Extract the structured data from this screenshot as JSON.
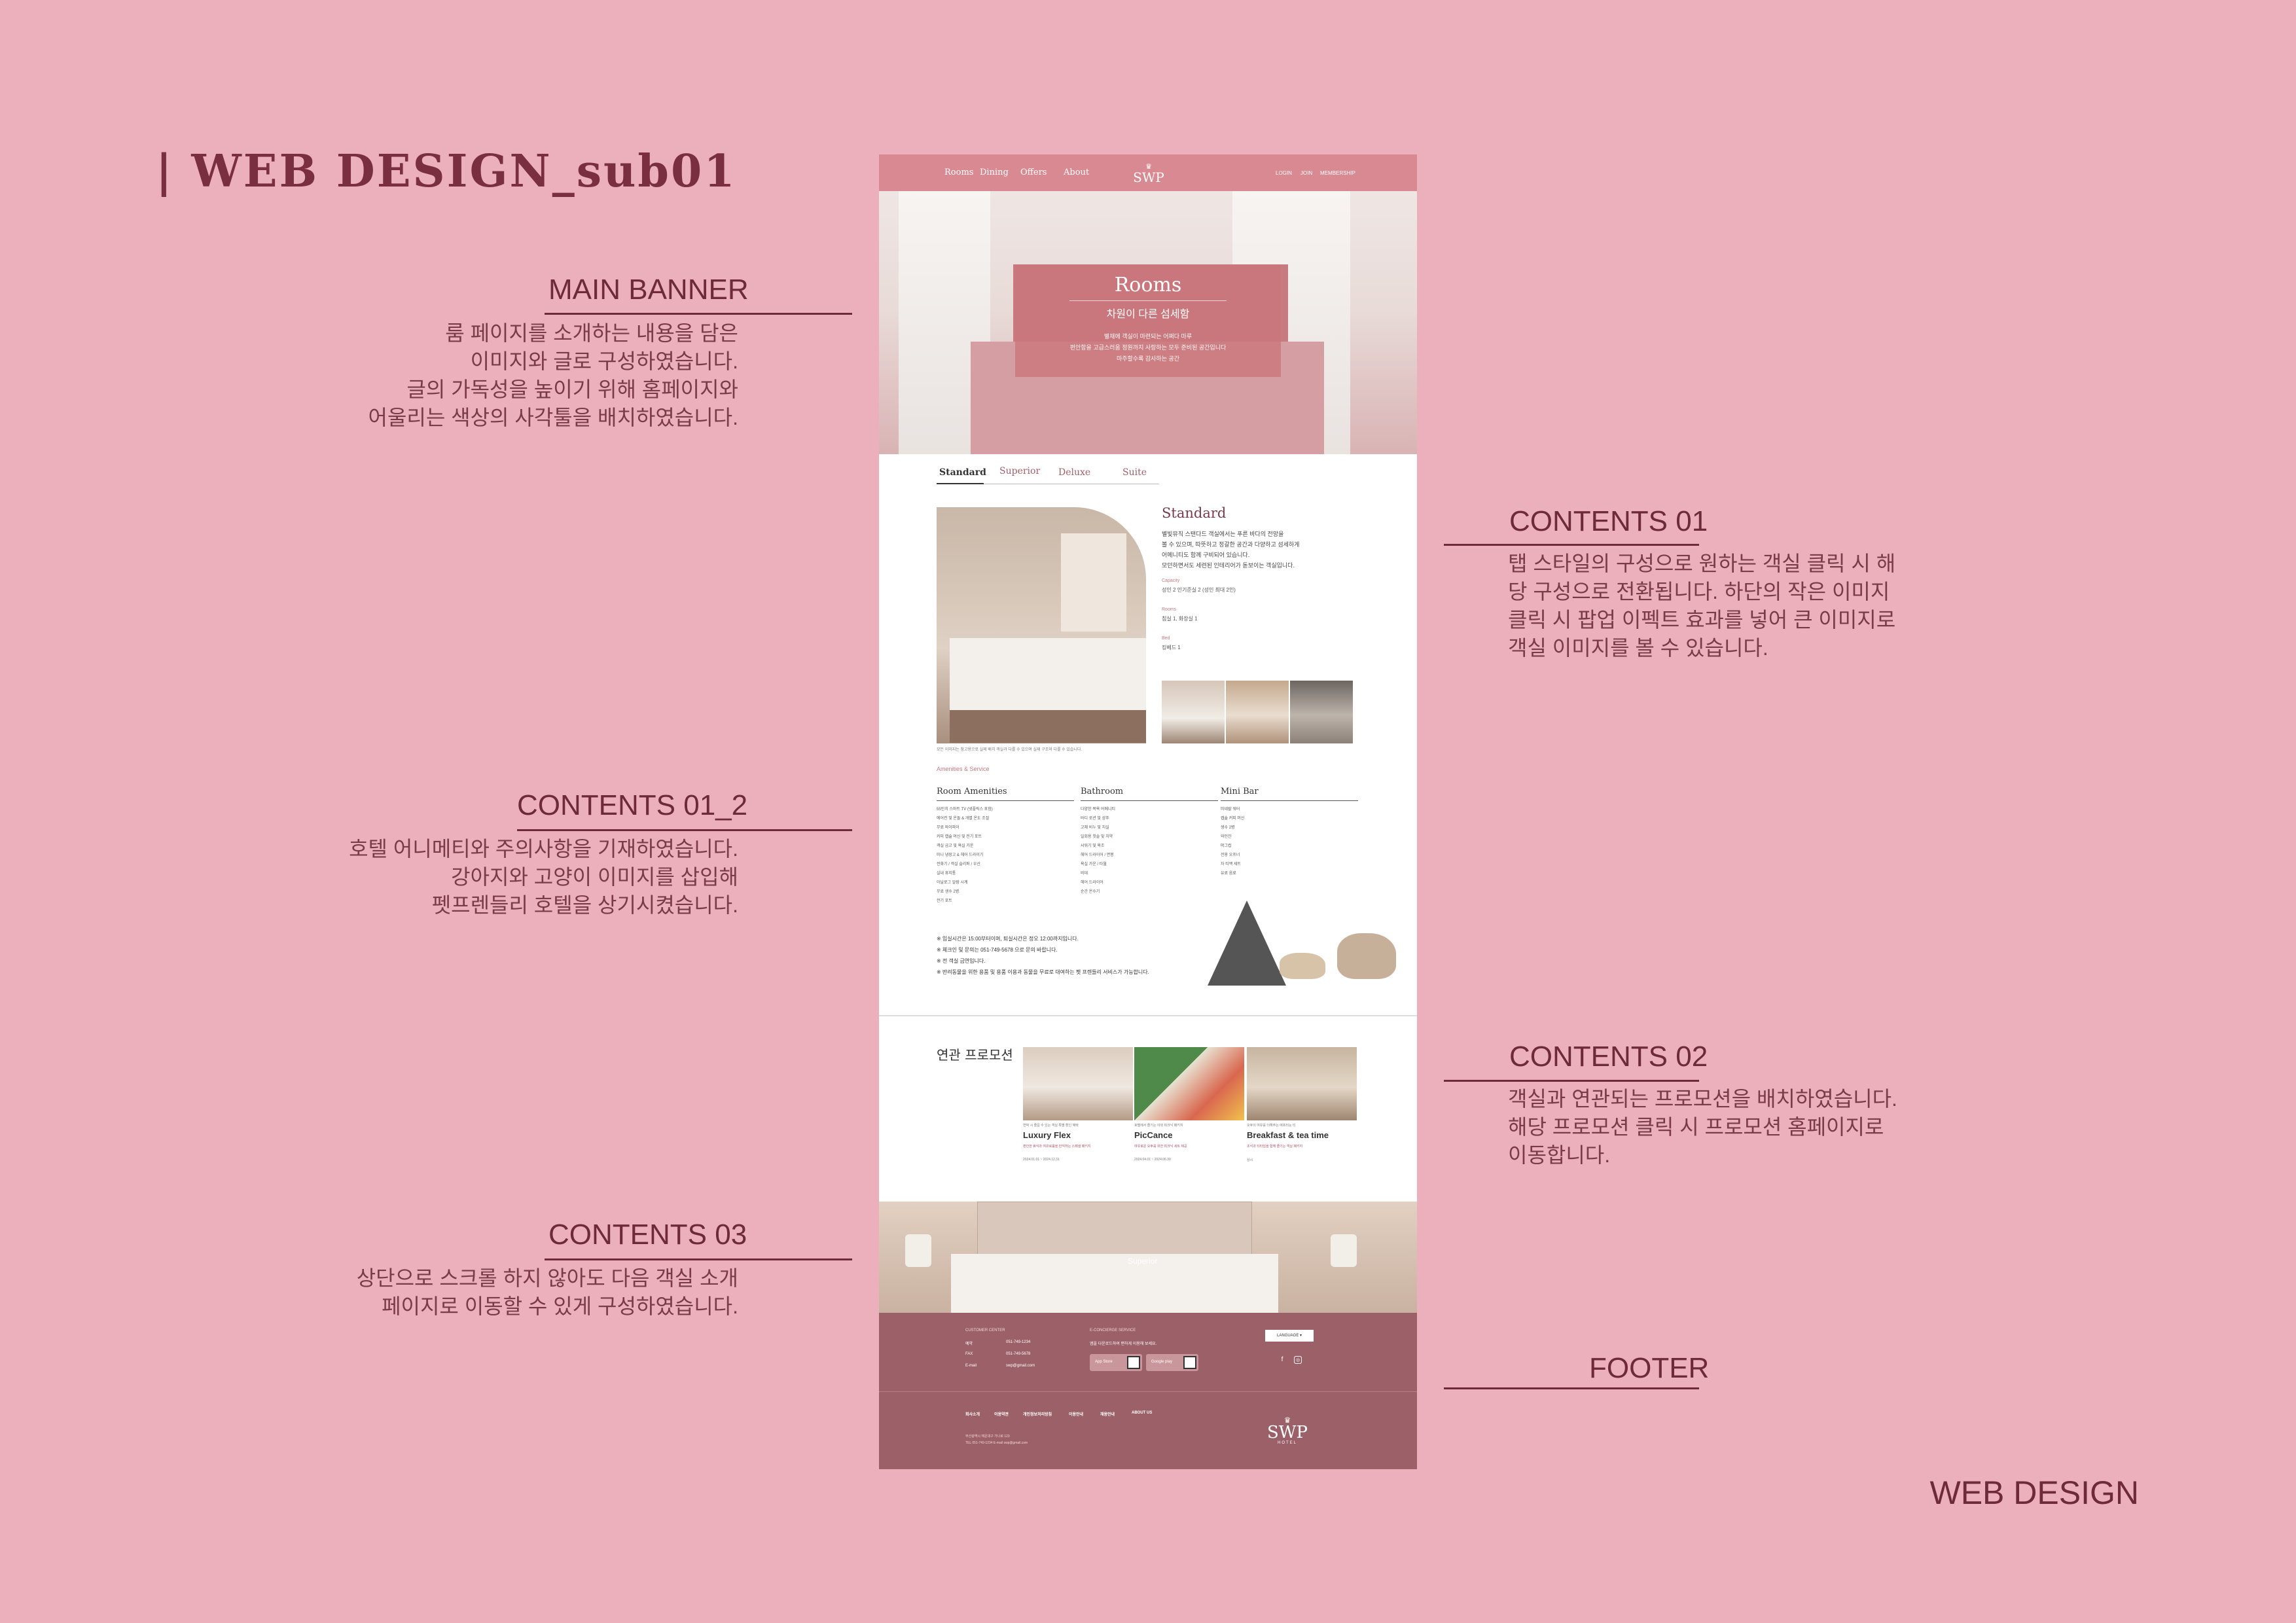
{
  "page_title": "| WEB  DESIGN_sub01",
  "footer_tag": "WEB DESIGN",
  "annotations": {
    "main_banner": {
      "title": "MAIN BANNER",
      "lines": [
        "룸 페이지를 소개하는 내용을 담은",
        "이미지와 글로 구성하였습니다.",
        "글의 가독성을 높이기 위해 홈페이지와",
        "어울리는 색상의 사각툴을 배치하였습니다."
      ]
    },
    "contents01": {
      "title": "CONTENTS 01",
      "lines": [
        "탭 스타일의 구성으로 원하는 객실 클릭 시 해",
        "당 구성으로 전환됩니다. 하단의 작은 이미지",
        "클릭 시 팝업 이펙트 효과를 넣어 큰 이미지로",
        "객실 이미지를 볼 수 있습니다."
      ]
    },
    "contents01_2": {
      "title": "CONTENTS 01_2",
      "lines": [
        "호텔 어니메티와 주의사항을 기재하였습니다.",
        "강아지와 고양이 이미지를 삽입해",
        "펫프렌들리 호텔을 상기시켰습니다."
      ]
    },
    "contents02": {
      "title": "CONTENTS 02",
      "lines": [
        "객실과 연관되는 프로모션을 배치하였습니다.",
        "해당 프로모션 클릭 시 프로모션 홈페이지로",
        "이동합니다."
      ]
    },
    "contents03": {
      "title": "CONTENTS 03",
      "lines": [
        "상단으로 스크롤 하지 않아도 다음 객실 소개",
        "페이지로 이동할 수 있게 구성하였습니다."
      ]
    },
    "footer": {
      "title": "FOOTER"
    }
  },
  "site": {
    "nav": [
      "Rooms",
      "Dining",
      "Offers",
      "About"
    ],
    "logo": "SWP",
    "logo_crown": "♛",
    "util": [
      "LOGIN",
      "JOIN",
      "MEMBERSHIP"
    ],
    "banner": {
      "title": "Rooms",
      "subtitle": "차원이 다른 섬세함",
      "desc": [
        "별채에 객실이 마련되는 어쩌다 마루",
        "편안함을 고급스러움 정원까지 사랑하는 모두 준비된 공간입니다",
        "마주할수록 감사하는 공간"
      ]
    },
    "tabs": [
      "Standard",
      "Superior",
      "Deluxe",
      "Suite"
    ],
    "room": {
      "name": "Standard",
      "desc": [
        "별빛뮤직 스탠다드 객실에서는 푸른 바다의 전망을",
        "볼 수 있으며, 따뜻하고 정갈한 공간과 다양하고 섬세하게",
        "어메니티도 함께 구비되어 있습니다.",
        "모던하면서도 세련된 인테리어가 돋보이는 객실입니다."
      ],
      "capacity_label": "Capacity",
      "capacity": "성인 2 인기준실 2 (성인 최대 2인)",
      "rooms_label": "Rooms",
      "rooms": "침실 1, 화장실 1",
      "bed_label": "Bed",
      "bed": "킹베드 1",
      "caption": "모든 이미지는 참고용으로 실제 배치 객실과 다를 수 있으며 실제 구조와 다를 수 있습니다."
    },
    "amenities": {
      "heading": "Amenities & Service",
      "columns": [
        {
          "title": "Room Amenities",
          "items": [
            "55인치 스마트 TV (넷플릭스 포함)",
            "에어컨 및 온돌 & 개별 온도 조절",
            "무료 와이파이",
            "커피 캡슐 머신 및 전기 포트",
            "객실 금고 및 욕실 가운",
            "미니 냉장고 & 헤어 드라이기",
            "전화기 / 객실 슬리퍼 / 우산",
            "실내 휴지통",
            "아날로그 알람 시계",
            "무료 생수 2병",
            "전기 포트"
          ]
        },
        {
          "title": "Bathroom",
          "items": [
            "다양한 목욕 어메니티",
            "바디 로션 및 샴푸",
            "고체 비누 및 치실",
            "일회용 칫솔 및 치약",
            "샤워기 및 욕조",
            "헤어 드라이어 / 면봉",
            "욕실 가운 / 타월",
            "비데",
            "헤어 드라이어",
            "순간 온수기"
          ]
        },
        {
          "title": "Mini Bar",
          "items": [
            "미네랄 워터",
            "캡슐 커피 머신",
            "생수 2병",
            "와인잔",
            "머그컵",
            "전용 오프너",
            "차 티백 세트",
            "유료 음료"
          ]
        }
      ],
      "notes": [
        "※ 입실시간은 15:00부터이며, 퇴실시간은 정오 12:00까지입니다.",
        "※ 체크인 및 문의는 051-749-5678 으로 문의 바랍니다.",
        "※ 전 객실 금연입니다.",
        "※ 반려동물을 위한 용품 및 용품 이용과 동물을 무료로 대여하는 펫 프렌들리 서비스가 가능합니다."
      ]
    },
    "promo": {
      "title": "연관 프로모션",
      "items": [
        {
          "small": "연박 시 즐길 수 있는 객실 특별 할인 혜택",
          "name": "Luxury Flex",
          "desc": "편안한 휴식과 여유로움을 만끽하는 스페셜 패키지",
          "date": "2024.01.01 ~ 2024.12.31"
        },
        {
          "small": "호텔에서 즐기는 야외 피크닉 패키지",
          "name": "PicCance",
          "desc": "여유로운 오후를 위한 피크닉 세트 제공",
          "date": "2024.04.01 ~ 2024.06.30"
        },
        {
          "small": "오후의 여유를 더해주는 애프터눈 티",
          "name": "Breakfast & tea time",
          "desc": "조식과 티타임을 함께 즐기는 객실 패키지",
          "date": "상시"
        }
      ]
    },
    "next_room": "Superior",
    "footer": {
      "customer_center": "CUSTOMER CENTER",
      "tel_label": "예약",
      "tel": "051-749-1234",
      "fax_label": "FAX",
      "fax": "051-749-5678",
      "mail_label": "E-mail",
      "mail": "swp@gmail.com",
      "concierge": "E-CONCIERGE SERVICE",
      "concierge_desc": "앱을 다운로드하여 편하게 이용해 보세요.",
      "app_store": "App Store",
      "google_play": "Google play",
      "language": "LANGUAGE",
      "links": [
        "회사소개",
        "이용약관",
        "개인정보처리방침",
        "이용안내",
        "채용안내",
        "ABOUT US"
      ],
      "address": [
        "부산광역시 해운대구 가나로 123",
        "TEL 051-749-1234 E-mail swp@gmail.com"
      ],
      "logo": "SWP",
      "logo_sub": "HOTEL"
    }
  }
}
